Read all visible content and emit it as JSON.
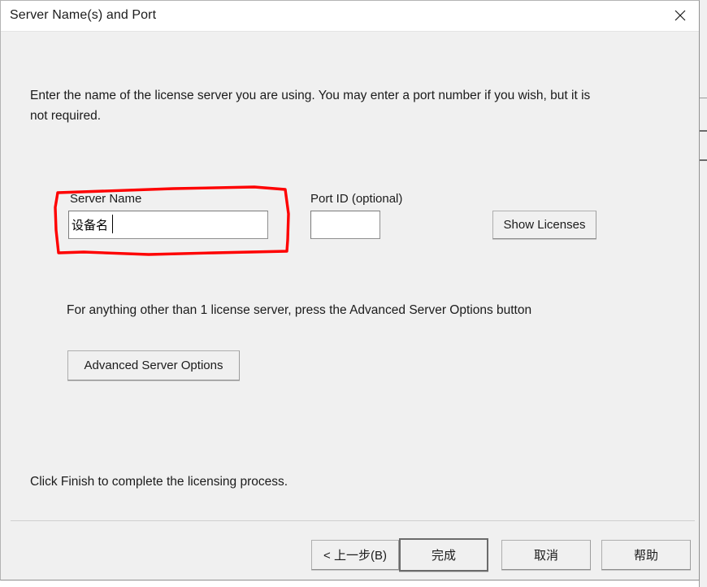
{
  "window": {
    "title": "Server Name(s) and Port",
    "close_icon": "close-icon"
  },
  "body": {
    "instruction": "Enter the name of the license server you are using.  You may enter a port number if you wish, but it is not required.",
    "hint": "For anything other than 1 license server, press the Advanced Server Options button",
    "finish_hint": "Click Finish to complete the licensing process."
  },
  "fields": {
    "server_name": {
      "label": "Server Name",
      "value": "设备名",
      "placeholder": "",
      "focused": true
    },
    "port_id": {
      "label": "Port ID (optional)",
      "value": "",
      "placeholder": "",
      "focused": false
    }
  },
  "buttons": {
    "show_licenses": "Show Licenses",
    "advanced_server_options": "Advanced Server Options",
    "back": "< 上一步(B)",
    "finish": "完成",
    "cancel": "取消",
    "help": "帮助"
  },
  "annotation": {
    "type": "hand-drawn-rectangle",
    "color": "#fe0000",
    "target": "server-name-field"
  },
  "colors": {
    "title_bar": "#ffffff",
    "dialog_background": "#f0f0f0",
    "text": "#1b1b1b",
    "input_background": "#ffffff",
    "annotation_red": "#fe0000",
    "default_button_border": "#6b6b6b"
  }
}
